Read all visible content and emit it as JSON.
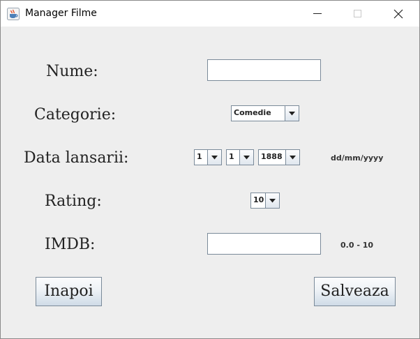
{
  "window": {
    "title": "Manager Filme",
    "app_icon": "java-coffee-cup-icon",
    "controls": [
      "minimize-icon",
      "maximize-icon",
      "close-icon"
    ]
  },
  "form": {
    "name_label": "Nume:",
    "name_value": "",
    "category_label": "Categorie:",
    "category_value": "Comedie",
    "release_label": "Data lansarii:",
    "day_value": "1",
    "month_value": "1",
    "year_value": "1888",
    "date_format_hint": "dd/mm/yyyy",
    "rating_label": "Rating:",
    "rating_value": "10",
    "imdb_label": "IMDB:",
    "imdb_value": "",
    "imdb_hint": "0.0 - 10"
  },
  "buttons": {
    "back_label": "Inapoi",
    "save_label": "Salveaza"
  },
  "colors": {
    "window_bg": "#eeeeee",
    "field_border": "#7a8a99"
  }
}
